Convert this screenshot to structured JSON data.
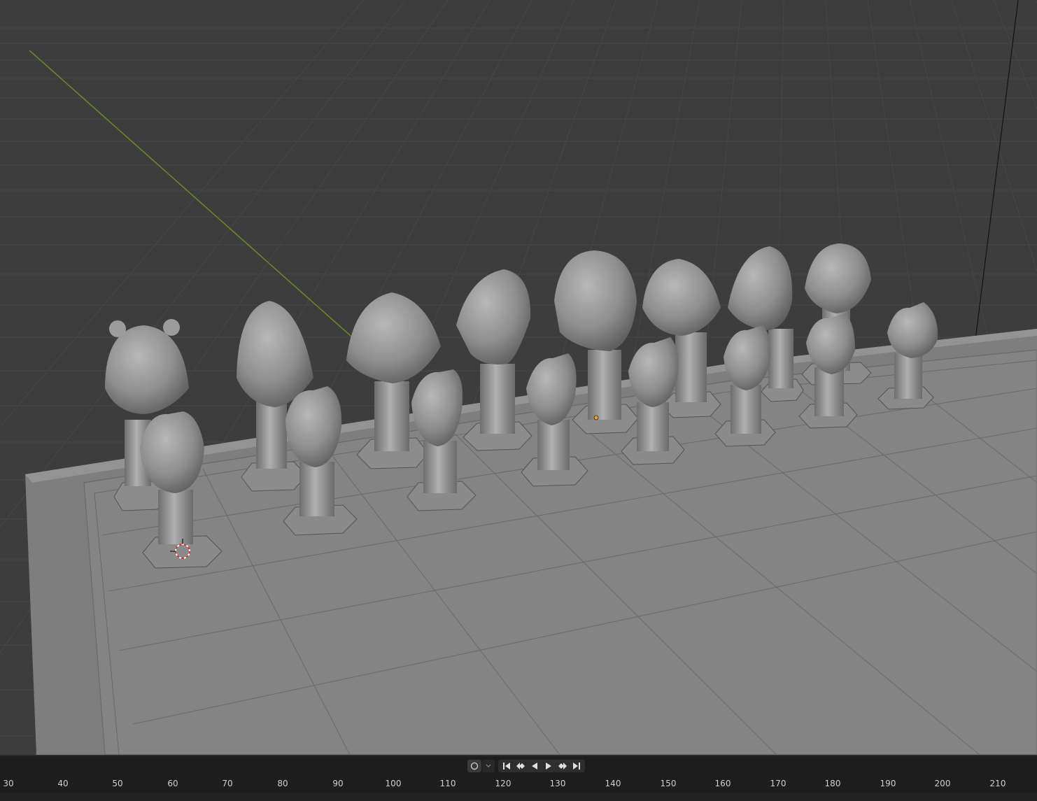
{
  "viewport": {
    "background": "#3d3d3d",
    "grid_color": "#4a4a4a",
    "y_axis_color": "#6b8e23",
    "board_color": "#858585",
    "piece_color": "#9a9a9a",
    "cursor_icon": "3d-cursor-icon",
    "pieces": {
      "back_rank": [
        "bear",
        "eagle",
        "gorilla",
        "panther",
        "lion",
        "gorilla",
        "eagle",
        "bear"
      ],
      "pawns": [
        "wolf",
        "wolf",
        "wolf",
        "wolf",
        "wolf",
        "wolf",
        "wolf",
        "wolf"
      ]
    }
  },
  "timeline": {
    "background": "#1d1d1d",
    "keying_icon": "record-circle-icon",
    "transport": [
      "jump-start-icon",
      "prev-keyframe-icon",
      "play-reverse-icon",
      "play-icon",
      "next-keyframe-icon",
      "jump-end-icon"
    ],
    "frames": [
      "30",
      "40",
      "50",
      "60",
      "70",
      "80",
      "90",
      "100",
      "110",
      "120",
      "130",
      "140",
      "150",
      "160",
      "170",
      "180",
      "190",
      "200",
      "210"
    ]
  }
}
